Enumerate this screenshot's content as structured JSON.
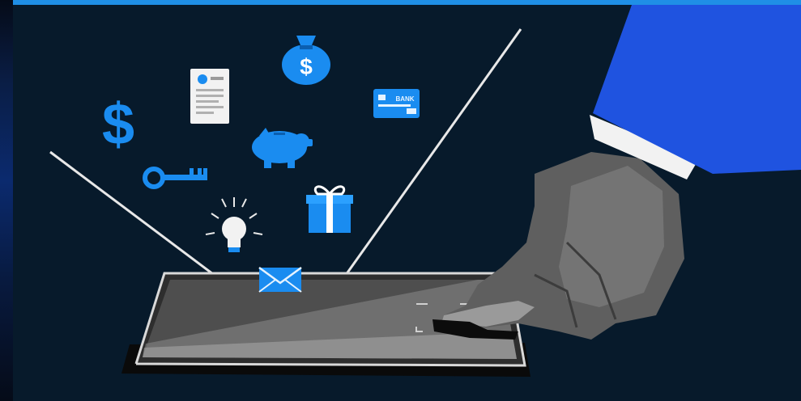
{
  "illustration": {
    "card_text": "BANK",
    "money_bag_symbol": "$",
    "dollar_symbol": "$",
    "icons": [
      "dollar-icon",
      "document-icon",
      "money-bag-icon",
      "bank-card-icon",
      "piggy-bank-icon",
      "key-icon",
      "gift-icon",
      "lightbulb-icon",
      "envelope-icon"
    ],
    "colors": {
      "background": "#071a2b",
      "accent_blue": "#1a8cf0",
      "sleeve_blue": "#1f53e0",
      "hand_gray": "#6f6f6f",
      "device_gray": "#4a4a4a",
      "top_strip": "#1f8fe6"
    }
  }
}
